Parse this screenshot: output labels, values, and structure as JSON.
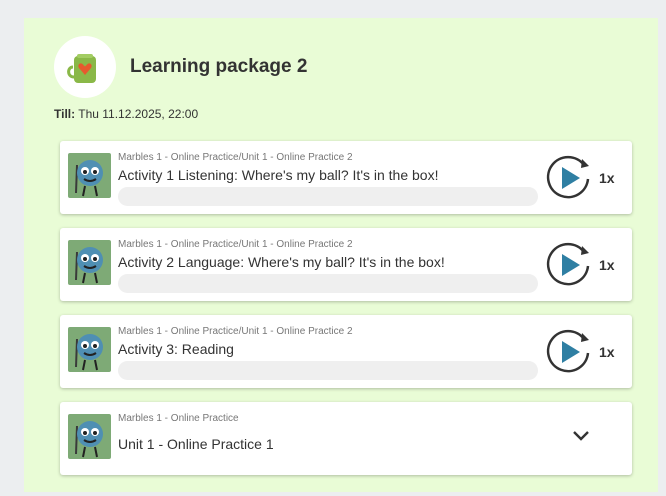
{
  "package": {
    "title": "Learning package 2",
    "till_label": "Till:",
    "till_value": "Thu 11.12.2025, 22:00"
  },
  "activities": [
    {
      "breadcrumb": "Marbles 1 - Online Practice/Unit 1 - Online Practice 2",
      "title": "Activity 1 Listening: Where's my ball? It's in the box!",
      "count": "1x"
    },
    {
      "breadcrumb": "Marbles 1 - Online Practice/Unit 1 - Online Practice 2",
      "title": "Activity 2 Language: Where's my ball? It's in the box!",
      "count": "1x"
    },
    {
      "breadcrumb": "Marbles 1 - Online Practice/Unit 1 - Online Practice 2",
      "title": "Activity 3: Reading",
      "count": "1x"
    }
  ],
  "unit": {
    "breadcrumb": "Marbles 1 - Online Practice",
    "title": "Unit 1 - Online Practice 1"
  },
  "icons": {
    "header": "mug-heart-icon",
    "thumbnail": "marble-character-icon",
    "replay": "replay-play-icon",
    "expand": "chevron-down-icon"
  },
  "colors": {
    "panel_bg": "#e9fcd6",
    "play_blue": "#2f7fa3",
    "mug_green": "#8ab848",
    "heart": "#e65a2e"
  }
}
